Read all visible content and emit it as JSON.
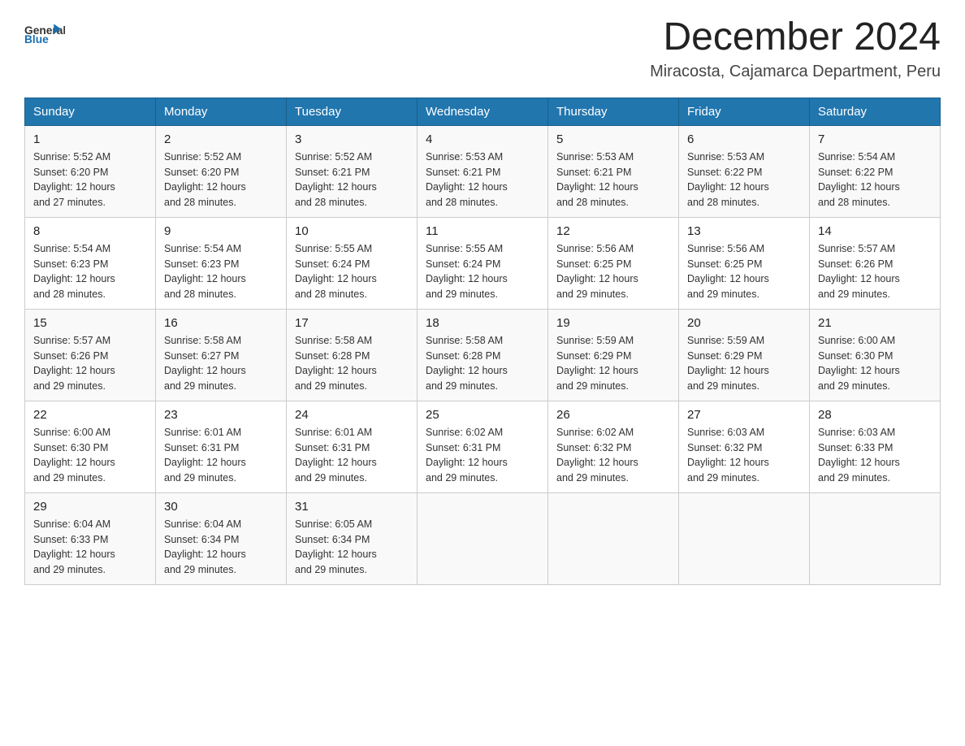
{
  "header": {
    "logo_general": "General",
    "logo_blue": "Blue",
    "month_title": "December 2024",
    "location": "Miracosta, Cajamarca Department, Peru"
  },
  "days_of_week": [
    "Sunday",
    "Monday",
    "Tuesday",
    "Wednesday",
    "Thursday",
    "Friday",
    "Saturday"
  ],
  "weeks": [
    [
      {
        "day": "1",
        "sunrise": "5:52 AM",
        "sunset": "6:20 PM",
        "daylight": "12 hours and 27 minutes."
      },
      {
        "day": "2",
        "sunrise": "5:52 AM",
        "sunset": "6:20 PM",
        "daylight": "12 hours and 28 minutes."
      },
      {
        "day": "3",
        "sunrise": "5:52 AM",
        "sunset": "6:21 PM",
        "daylight": "12 hours and 28 minutes."
      },
      {
        "day": "4",
        "sunrise": "5:53 AM",
        "sunset": "6:21 PM",
        "daylight": "12 hours and 28 minutes."
      },
      {
        "day": "5",
        "sunrise": "5:53 AM",
        "sunset": "6:21 PM",
        "daylight": "12 hours and 28 minutes."
      },
      {
        "day": "6",
        "sunrise": "5:53 AM",
        "sunset": "6:22 PM",
        "daylight": "12 hours and 28 minutes."
      },
      {
        "day": "7",
        "sunrise": "5:54 AM",
        "sunset": "6:22 PM",
        "daylight": "12 hours and 28 minutes."
      }
    ],
    [
      {
        "day": "8",
        "sunrise": "5:54 AM",
        "sunset": "6:23 PM",
        "daylight": "12 hours and 28 minutes."
      },
      {
        "day": "9",
        "sunrise": "5:54 AM",
        "sunset": "6:23 PM",
        "daylight": "12 hours and 28 minutes."
      },
      {
        "day": "10",
        "sunrise": "5:55 AM",
        "sunset": "6:24 PM",
        "daylight": "12 hours and 28 minutes."
      },
      {
        "day": "11",
        "sunrise": "5:55 AM",
        "sunset": "6:24 PM",
        "daylight": "12 hours and 29 minutes."
      },
      {
        "day": "12",
        "sunrise": "5:56 AM",
        "sunset": "6:25 PM",
        "daylight": "12 hours and 29 minutes."
      },
      {
        "day": "13",
        "sunrise": "5:56 AM",
        "sunset": "6:25 PM",
        "daylight": "12 hours and 29 minutes."
      },
      {
        "day": "14",
        "sunrise": "5:57 AM",
        "sunset": "6:26 PM",
        "daylight": "12 hours and 29 minutes."
      }
    ],
    [
      {
        "day": "15",
        "sunrise": "5:57 AM",
        "sunset": "6:26 PM",
        "daylight": "12 hours and 29 minutes."
      },
      {
        "day": "16",
        "sunrise": "5:58 AM",
        "sunset": "6:27 PM",
        "daylight": "12 hours and 29 minutes."
      },
      {
        "day": "17",
        "sunrise": "5:58 AM",
        "sunset": "6:28 PM",
        "daylight": "12 hours and 29 minutes."
      },
      {
        "day": "18",
        "sunrise": "5:58 AM",
        "sunset": "6:28 PM",
        "daylight": "12 hours and 29 minutes."
      },
      {
        "day": "19",
        "sunrise": "5:59 AM",
        "sunset": "6:29 PM",
        "daylight": "12 hours and 29 minutes."
      },
      {
        "day": "20",
        "sunrise": "5:59 AM",
        "sunset": "6:29 PM",
        "daylight": "12 hours and 29 minutes."
      },
      {
        "day": "21",
        "sunrise": "6:00 AM",
        "sunset": "6:30 PM",
        "daylight": "12 hours and 29 minutes."
      }
    ],
    [
      {
        "day": "22",
        "sunrise": "6:00 AM",
        "sunset": "6:30 PM",
        "daylight": "12 hours and 29 minutes."
      },
      {
        "day": "23",
        "sunrise": "6:01 AM",
        "sunset": "6:31 PM",
        "daylight": "12 hours and 29 minutes."
      },
      {
        "day": "24",
        "sunrise": "6:01 AM",
        "sunset": "6:31 PM",
        "daylight": "12 hours and 29 minutes."
      },
      {
        "day": "25",
        "sunrise": "6:02 AM",
        "sunset": "6:31 PM",
        "daylight": "12 hours and 29 minutes."
      },
      {
        "day": "26",
        "sunrise": "6:02 AM",
        "sunset": "6:32 PM",
        "daylight": "12 hours and 29 minutes."
      },
      {
        "day": "27",
        "sunrise": "6:03 AM",
        "sunset": "6:32 PM",
        "daylight": "12 hours and 29 minutes."
      },
      {
        "day": "28",
        "sunrise": "6:03 AM",
        "sunset": "6:33 PM",
        "daylight": "12 hours and 29 minutes."
      }
    ],
    [
      {
        "day": "29",
        "sunrise": "6:04 AM",
        "sunset": "6:33 PM",
        "daylight": "12 hours and 29 minutes."
      },
      {
        "day": "30",
        "sunrise": "6:04 AM",
        "sunset": "6:34 PM",
        "daylight": "12 hours and 29 minutes."
      },
      {
        "day": "31",
        "sunrise": "6:05 AM",
        "sunset": "6:34 PM",
        "daylight": "12 hours and 29 minutes."
      },
      null,
      null,
      null,
      null
    ]
  ],
  "labels": {
    "sunrise": "Sunrise:",
    "sunset": "Sunset:",
    "daylight": "Daylight:"
  }
}
